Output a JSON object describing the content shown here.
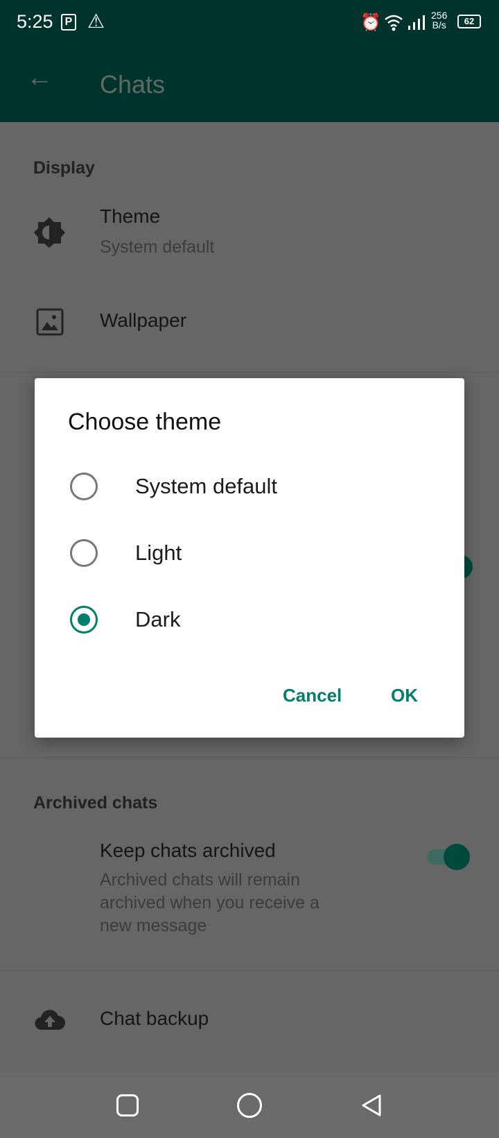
{
  "status_bar": {
    "time": "5:25",
    "net_speed_value": "256",
    "net_speed_unit": "B/s",
    "battery": "62",
    "icons": [
      "parking-icon",
      "warning-icon",
      "alarm-icon",
      "wifi-icon",
      "signal-icon",
      "battery-icon"
    ]
  },
  "app_bar": {
    "title": "Chats",
    "back_icon": "arrow-left-icon"
  },
  "sections": {
    "display": {
      "header": "Display",
      "theme_title": "Theme",
      "theme_value": "System default",
      "wallpaper": "Wallpaper"
    },
    "archived": {
      "header": "Archived chats",
      "keep_title": "Keep chats archived",
      "keep_desc_lines": [
        "Archived chats will remain",
        "archived when you receive a",
        "new message"
      ],
      "keep_enabled": true
    },
    "backup": {
      "title": "Chat backup"
    }
  },
  "dialog": {
    "title": "Choose theme",
    "options": [
      {
        "label": "System default",
        "selected": false
      },
      {
        "label": "Light",
        "selected": false
      },
      {
        "label": "Dark",
        "selected": true
      }
    ],
    "cancel": "Cancel",
    "ok": "OK"
  },
  "colors": {
    "accent": "#008069",
    "app_bar": "#00332c"
  }
}
